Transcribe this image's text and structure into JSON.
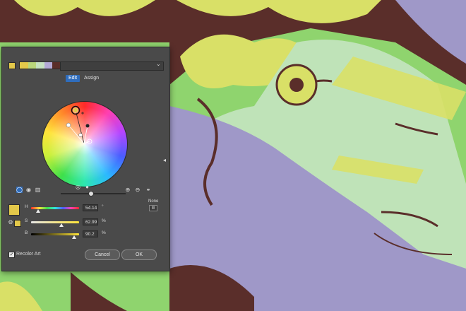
{
  "toolbar": {
    "menu_chevron": "⌄"
  },
  "tabs": {
    "edit": "Edit",
    "assign": "Assign"
  },
  "colors": {
    "accent": "#e3c84a",
    "tab_active": "#2f6dbd",
    "dialog_bg": "#4a4a4a",
    "art_green": "#8fd46e",
    "art_brown": "#5a2e2a",
    "art_yellow": "#d9e067",
    "art_lavender": "#9f98c8",
    "art_mint": "#bfe3b8"
  },
  "sliders": [
    {
      "label": "H",
      "value": "54.14",
      "unit": "°",
      "level": 0.15
    },
    {
      "label": "S",
      "value": "62.99",
      "unit": "%",
      "level": 0.63
    },
    {
      "label": "B",
      "value": "90.2",
      "unit": "%",
      "level": 0.9
    }
  ],
  "side_label": "None",
  "recolor_label": "Recolor Art",
  "cancel_label": "Cancel",
  "ok_label": "OK"
}
